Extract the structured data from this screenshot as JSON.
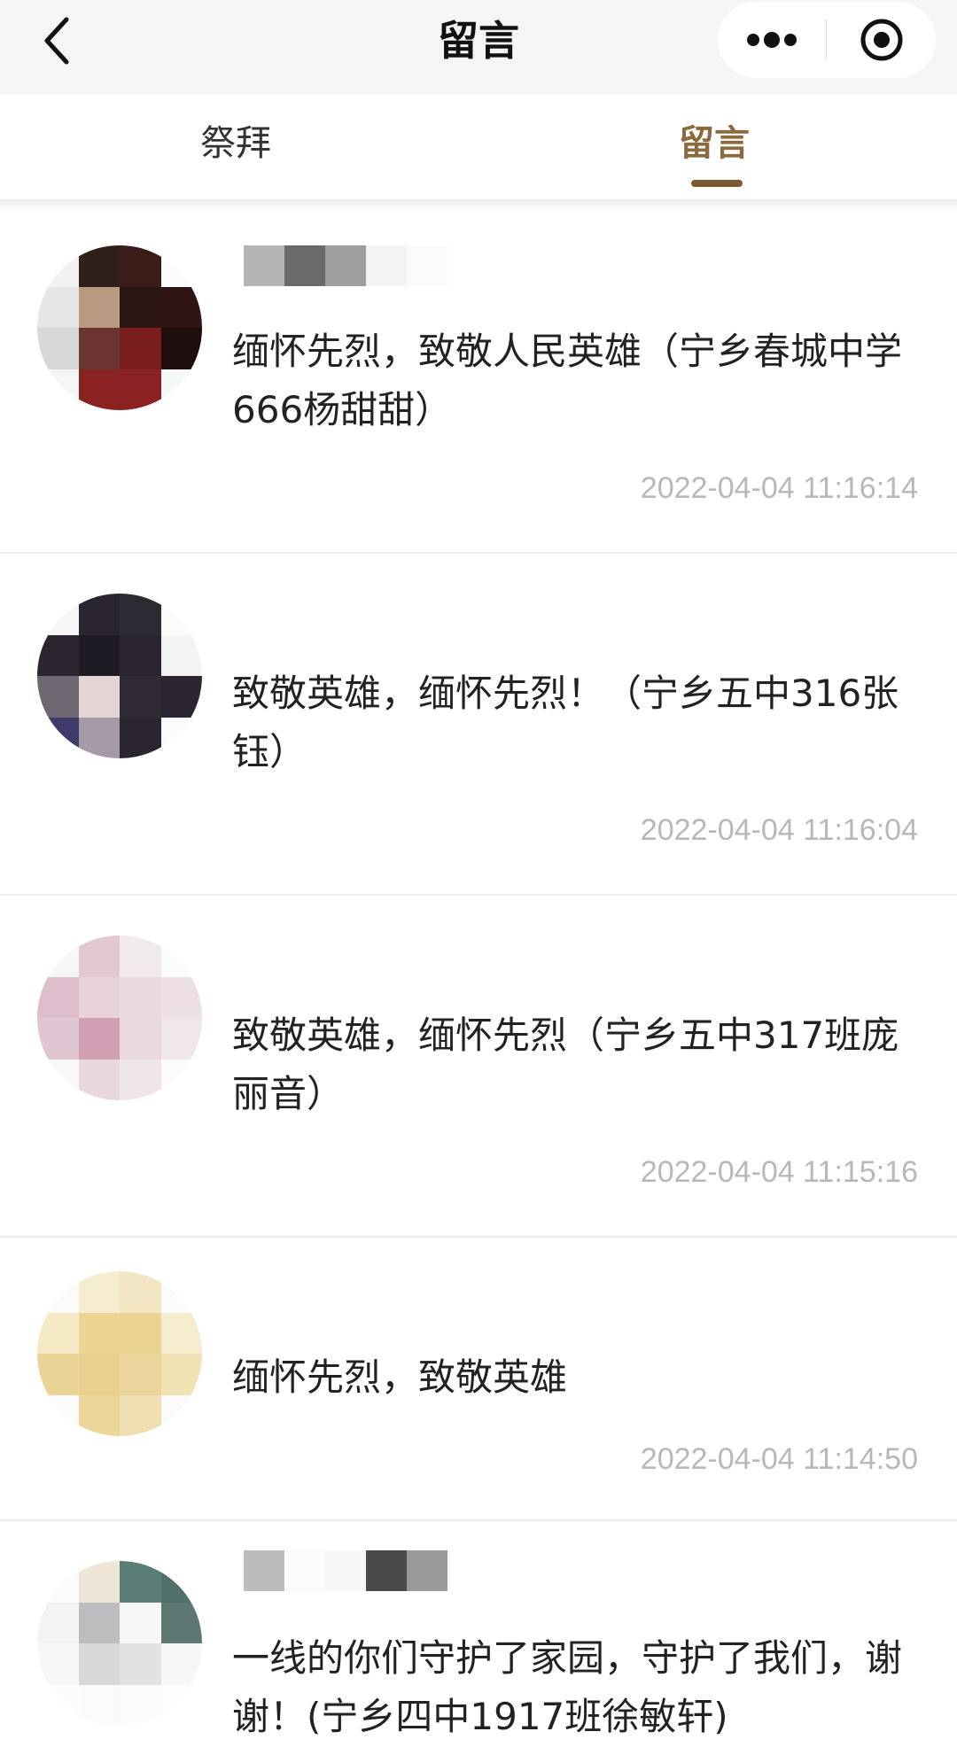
{
  "navbar": {
    "title": "留言",
    "back_icon": "chevron-left-icon",
    "more_icon": "more-dots-icon",
    "close_icon": "target-close-icon"
  },
  "tabs": [
    {
      "label": "祭拜",
      "active": false
    },
    {
      "label": "留言",
      "active": true
    }
  ],
  "colors": {
    "accent": "#8b6b3d",
    "underline": "#7a5a2e",
    "text": "#222222",
    "timestamp": "#b8b8b8"
  },
  "comments": [
    {
      "message": "缅怀先烈，致敬人民英雄（宁乡春城中学666杨甜甜）",
      "time": "2022-04-04 11:16:14"
    },
    {
      "message": "致敬英雄，缅怀先烈！（宁乡五中316张钰）",
      "time": "2022-04-04 11:16:04"
    },
    {
      "message": "致敬英雄，缅怀先烈（宁乡五中317班庞丽音）",
      "time": "2022-04-04 11:15:16"
    },
    {
      "message": "缅怀先烈，致敬英雄",
      "time": "2022-04-04 11:14:50"
    },
    {
      "message": "一线的你们守护了家园，守护了我们，谢谢！(宁乡四中1917班徐敏轩)",
      "time": ""
    }
  ]
}
